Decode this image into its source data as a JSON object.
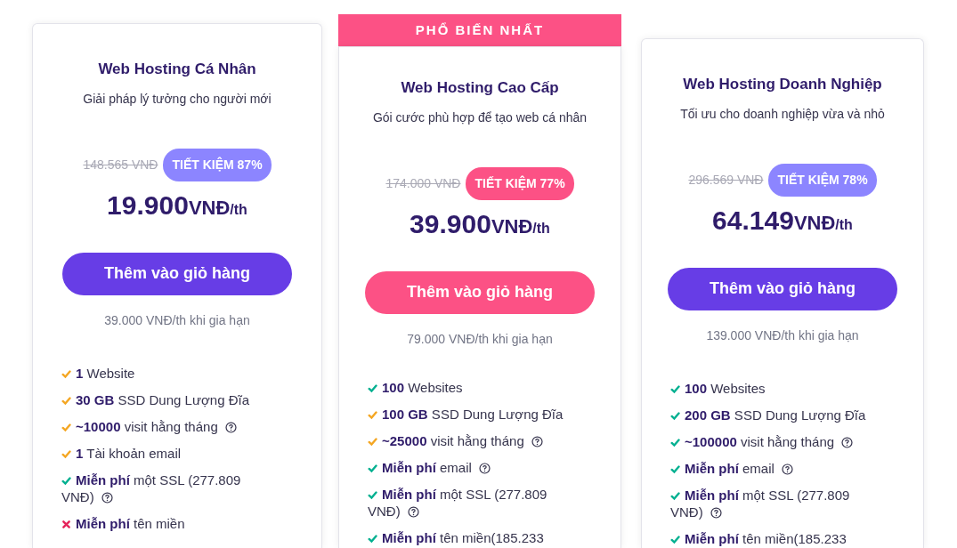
{
  "plans": [
    {
      "title": "Web Hosting Cá Nhân",
      "subtitle": "Giải pháp lý tưởng cho người mới",
      "old_price": "148.565 VNĐ",
      "badge": {
        "text": "TIẾT KIỆM 87%",
        "color": "#8c85ff"
      },
      "color": "#673de6",
      "price": {
        "amount": "19.900",
        "currency": "VNĐ",
        "period": "/th"
      },
      "button": "Thêm vào giỏ hàng",
      "renewal": "39.000 VNĐ/th khi gia hạn",
      "features": [
        {
          "kind": "check",
          "color": "#f4a622",
          "text": "**1** Website",
          "help": false
        },
        {
          "kind": "check",
          "color": "#f4a622",
          "text": "**30 GB** SSD Dung Lượng Đĩa",
          "help": false
        },
        {
          "kind": "check",
          "color": "#f4a622",
          "text": "**~10000** visit hằng tháng",
          "help": true
        },
        {
          "kind": "check",
          "color": "#f4a622",
          "text": "**1** Tài khoản email",
          "help": false
        },
        {
          "kind": "check",
          "color": "#00b090",
          "text": "**Miễn phí** một SSL (277.809 VNĐ)",
          "help": true
        },
        {
          "kind": "cross",
          "color": "#e5245b",
          "text": "**Miễn phí** tên miền",
          "help": false
        }
      ]
    },
    {
      "banner": "PHỔ BIẾN NHẤT",
      "title": "Web Hosting Cao Cấp",
      "subtitle": "Gói cước phù hợp để tạo web cá nhân",
      "old_price": "174.000 VNĐ",
      "badge": {
        "text": "TIẾT KIỆM 77%",
        "color": "#fc5185"
      },
      "color": "#fc5185",
      "price": {
        "amount": "39.900",
        "currency": "VNĐ",
        "period": "/th"
      },
      "button": "Thêm vào giỏ hàng",
      "renewal": "79.000 VNĐ/th khi gia hạn",
      "features": [
        {
          "kind": "check",
          "color": "#00b090",
          "text": "**100** Websites",
          "help": false
        },
        {
          "kind": "check",
          "color": "#f4a622",
          "text": "**100 GB** SSD Dung Lượng Đĩa",
          "help": false
        },
        {
          "kind": "check",
          "color": "#f4a622",
          "text": "**~25000** visit hằng tháng",
          "help": true
        },
        {
          "kind": "check",
          "color": "#00b090",
          "text": "**Miễn phí** email",
          "help": true
        },
        {
          "kind": "check",
          "color": "#00b090",
          "text": "**Miễn phí** một SSL (277.809 VNĐ)",
          "help": true
        },
        {
          "kind": "check",
          "color": "#00b090",
          "text": "**Miễn phí** tên miền(185.233",
          "help": false
        }
      ]
    },
    {
      "title": "Web Hosting Doanh Nghiệp",
      "subtitle": "Tối ưu cho doanh nghiệp vừa và nhỏ",
      "old_price": "296.569 VNĐ",
      "badge": {
        "text": "TIẾT KIỆM 78%",
        "color": "#8c85ff"
      },
      "color": "#673de6",
      "price": {
        "amount": "64.149",
        "currency": "VNĐ",
        "period": "/th"
      },
      "button": "Thêm vào giỏ hàng",
      "renewal": "139.000 VNĐ/th khi gia hạn",
      "features": [
        {
          "kind": "check",
          "color": "#00b090",
          "text": "**100** Websites",
          "help": false
        },
        {
          "kind": "check",
          "color": "#00b090",
          "text": "**200 GB** SSD Dung Lượng Đĩa",
          "help": false
        },
        {
          "kind": "check",
          "color": "#00b090",
          "text": "**~100000** visit hằng tháng",
          "help": true
        },
        {
          "kind": "check",
          "color": "#00b090",
          "text": "**Miễn phí** email",
          "help": true
        },
        {
          "kind": "check",
          "color": "#00b090",
          "text": "**Miễn phí** một SSL (277.809 VNĐ)",
          "help": true
        },
        {
          "kind": "check",
          "color": "#00b090",
          "text": "**Miễn phí** tên miền(185.233",
          "help": false
        }
      ]
    }
  ]
}
